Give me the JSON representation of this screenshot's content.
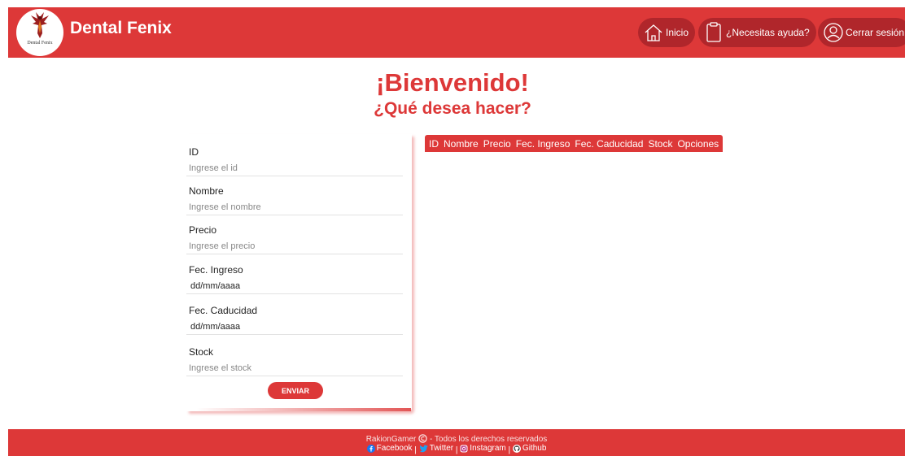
{
  "header": {
    "brand": "Dental Fenix",
    "logo_text": "Dental Fenix",
    "nav": [
      {
        "label": "Inicio",
        "icon": "home-icon"
      },
      {
        "label": "¿Necesitas ayuda?",
        "icon": "clipboard-icon"
      },
      {
        "label": "Cerrar sesión",
        "icon": "user-icon"
      }
    ]
  },
  "main": {
    "title": "¡Bienvenido!",
    "subtitle": "¿Qué desea hacer?"
  },
  "form": {
    "fields": [
      {
        "label": "ID",
        "placeholder": "Ingrese el id"
      },
      {
        "label": "Nombre",
        "placeholder": "Ingrese el nombre"
      },
      {
        "label": "Precio",
        "placeholder": "Ingrese el precio"
      },
      {
        "label": "Fec. Ingreso",
        "value": "dd/mm/aaaa"
      },
      {
        "label": "Fec. Caducidad",
        "value": "dd/mm/aaaa"
      },
      {
        "label": "Stock",
        "placeholder": "Ingrese el stock"
      }
    ],
    "submit_label": "ENVIAR"
  },
  "table": {
    "columns": [
      "ID",
      "Nombre",
      "Precio",
      "Fec. Ingreso",
      "Fec. Caducidad",
      "Stock",
      "Opciones"
    ],
    "rows": []
  },
  "footer": {
    "author": "RakionGamer",
    "rights": " - Todos los derechos reservados",
    "links": [
      {
        "label": "Facebook",
        "icon": "facebook-icon"
      },
      {
        "label": "Twitter",
        "icon": "twitter-icon"
      },
      {
        "label": "Instagram",
        "icon": "instagram-icon"
      },
      {
        "label": "Github",
        "icon": "github-icon"
      }
    ],
    "separator": " | "
  },
  "colors": {
    "primary": "#dd3838",
    "button_dark": "#b0262b",
    "facebook": "#1877f2",
    "twitter": "#1da1f2"
  }
}
